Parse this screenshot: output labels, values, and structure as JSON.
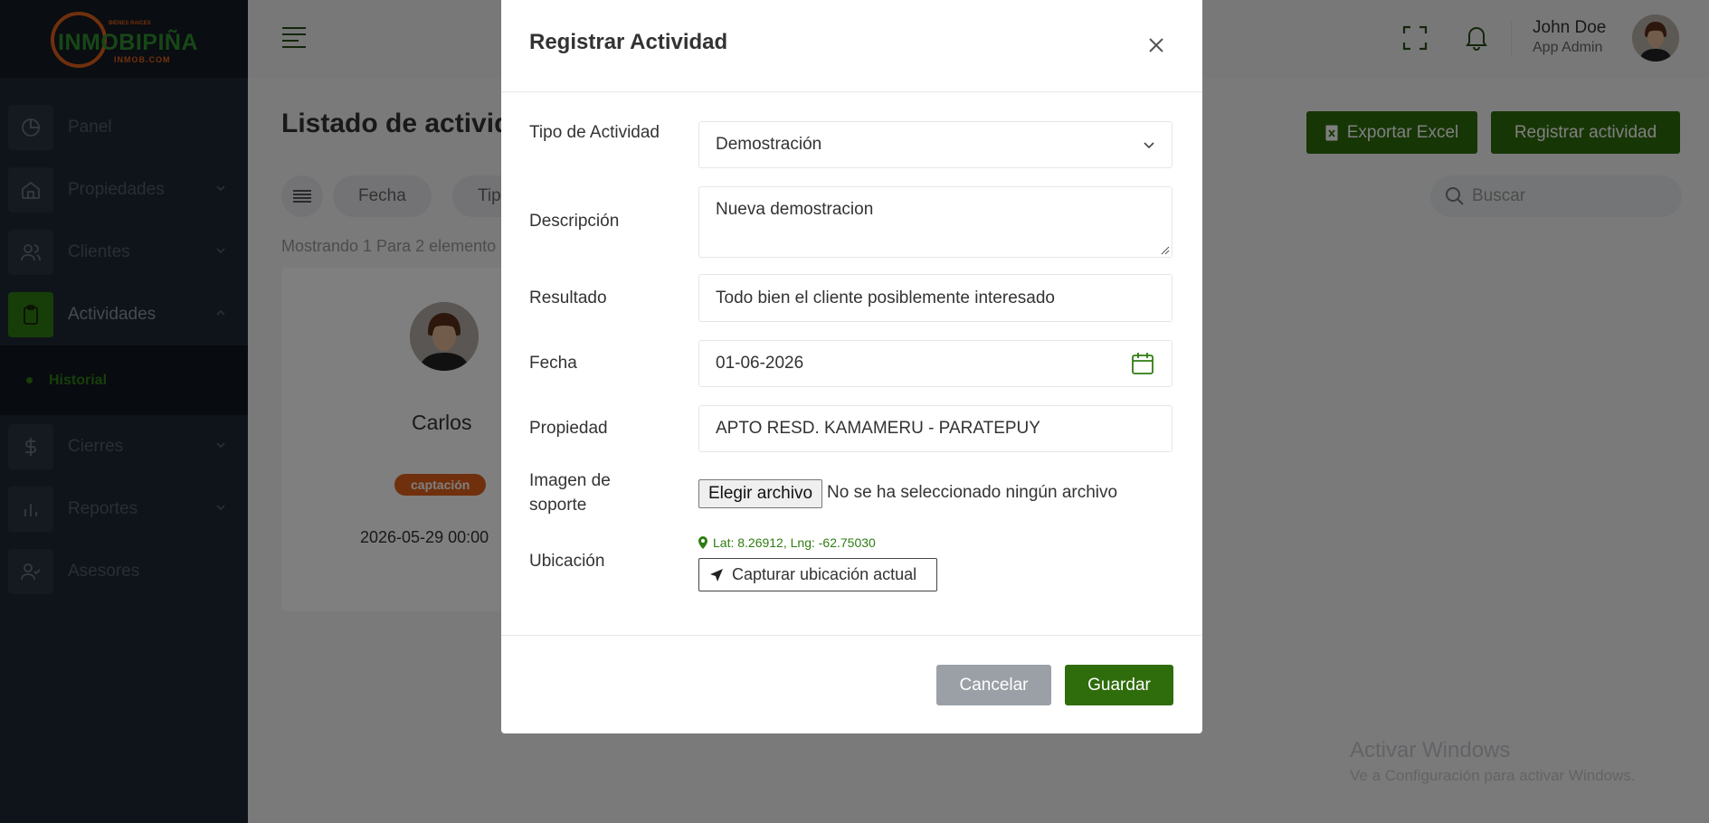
{
  "brand": {
    "logo_text": "INMOBIPIÑA",
    "logo_tag": "BIENES RAICES",
    "logo_sub": "INMOB.COM"
  },
  "sidebar": {
    "items": [
      {
        "label": "Panel",
        "icon": "pie-chart-icon"
      },
      {
        "label": "Propiedades",
        "icon": "home-icon"
      },
      {
        "label": "Clientes",
        "icon": "users-icon"
      },
      {
        "label": "Actividades",
        "icon": "clipboard-icon"
      },
      {
        "label": "Cierres",
        "icon": "dollar-icon"
      },
      {
        "label": "Reportes",
        "icon": "bar-chart-icon"
      },
      {
        "label": "Asesores",
        "icon": "user-check-icon"
      }
    ],
    "sub_item": "Historial",
    "accent": "#2f7d12"
  },
  "header": {
    "user_name": "John Doe",
    "user_role": "App Admin"
  },
  "main": {
    "title": "Listado de activid",
    "export_button": "Exportar Excel",
    "register_button": "Registrar actividad",
    "filters": [
      "Fecha",
      "Tip"
    ],
    "search_placeholder": "Buscar",
    "showing_text": "Mostrando 1 Para 2 elemento",
    "card": {
      "name": "Carlos",
      "badge": "captación",
      "date": "2026-05-29 00:00"
    }
  },
  "modal": {
    "title": "Registrar Actividad",
    "fields": {
      "tipo_label": "Tipo de Actividad",
      "tipo_value": "Demostración",
      "descripcion_label": "Descripción",
      "descripcion_value": "Nueva demostracion",
      "resultado_label": "Resultado",
      "resultado_value": "Todo bien el cliente posiblemente interesado",
      "fecha_label": "Fecha",
      "fecha_value": "01-06-2026",
      "propiedad_label": "Propiedad",
      "propiedad_value": "APTO RESD. KAMAMERU - PARATEPUY",
      "imagen_label": "Imagen de soporte",
      "file_button": "Elegir archivo",
      "file_status": "No se ha seleccionado ningún archivo",
      "ubicacion_label": "Ubicación",
      "coords": "Lat: 8.26912, Lng: -62.75030",
      "capture_button": "Capturar ubicación actual"
    },
    "cancel_button": "Cancelar",
    "save_button": "Guardar",
    "primary_color": "#2f6d0c"
  },
  "watermark": {
    "line1": "Activar Windows",
    "line2": "Ve a Configuración para activar Windows."
  }
}
